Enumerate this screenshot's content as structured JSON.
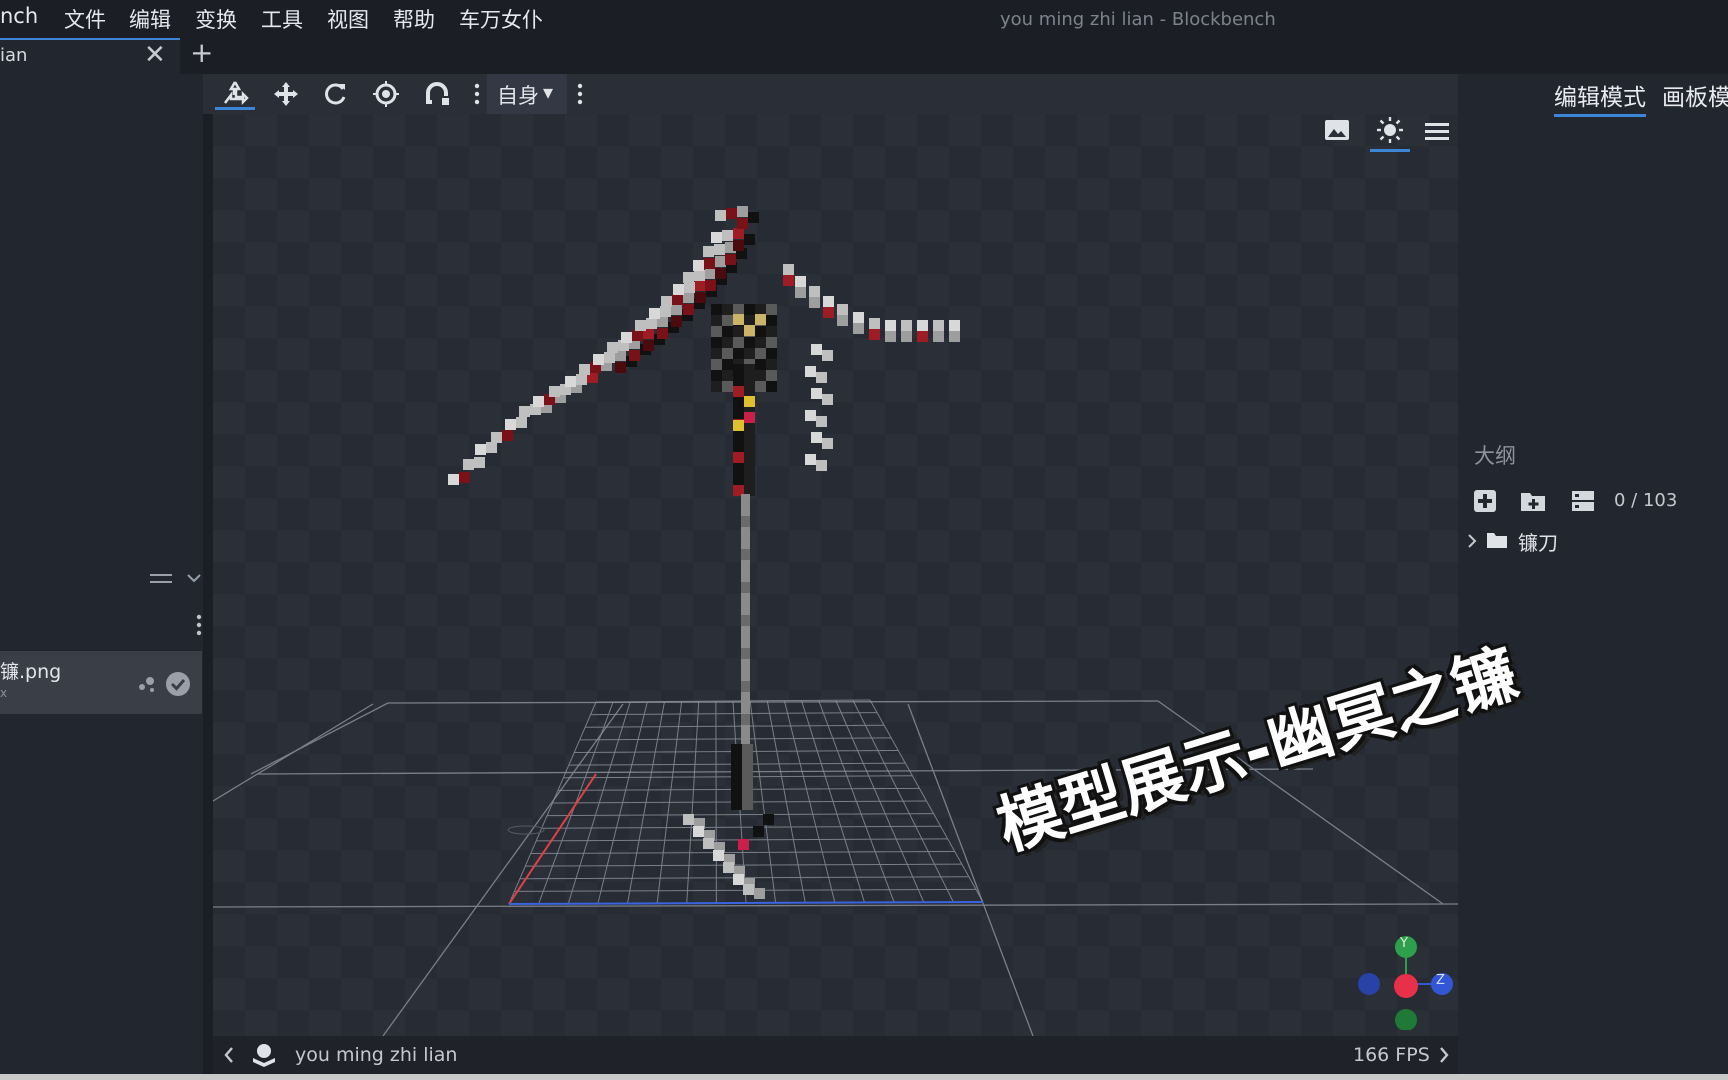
{
  "menubar": {
    "app_name_fragment": "nch",
    "items": [
      "文件",
      "编辑",
      "变换",
      "工具",
      "视图",
      "帮助",
      "车万女仆"
    ],
    "window_title": "you ming zhi lian - Blockbench"
  },
  "tabs": {
    "file_tab_label": "ian",
    "close_glyph": "✕",
    "add_glyph": "+"
  },
  "toolbar": {
    "transform_space": "自身",
    "transform_space_caret": "▾"
  },
  "mode_tabs": {
    "edit": "编辑模式",
    "paint": "画板模"
  },
  "outliner": {
    "title": "大纲",
    "count": "0 / 103",
    "root_group": "镰刀",
    "expand_glyph": "›"
  },
  "textures": {
    "item_name": "镰.png",
    "item_sub": "x"
  },
  "statusbar": {
    "model_name": "you ming zhi lian",
    "fps": "166 FPS"
  },
  "overlay": {
    "caption": "模型展示-幽冥之镰"
  },
  "gizmo": {
    "y_label": "Y",
    "z_label": "Z",
    "x_color": "#e8304a",
    "y_color": "#2e9f4a",
    "z_color": "#3356d6"
  }
}
